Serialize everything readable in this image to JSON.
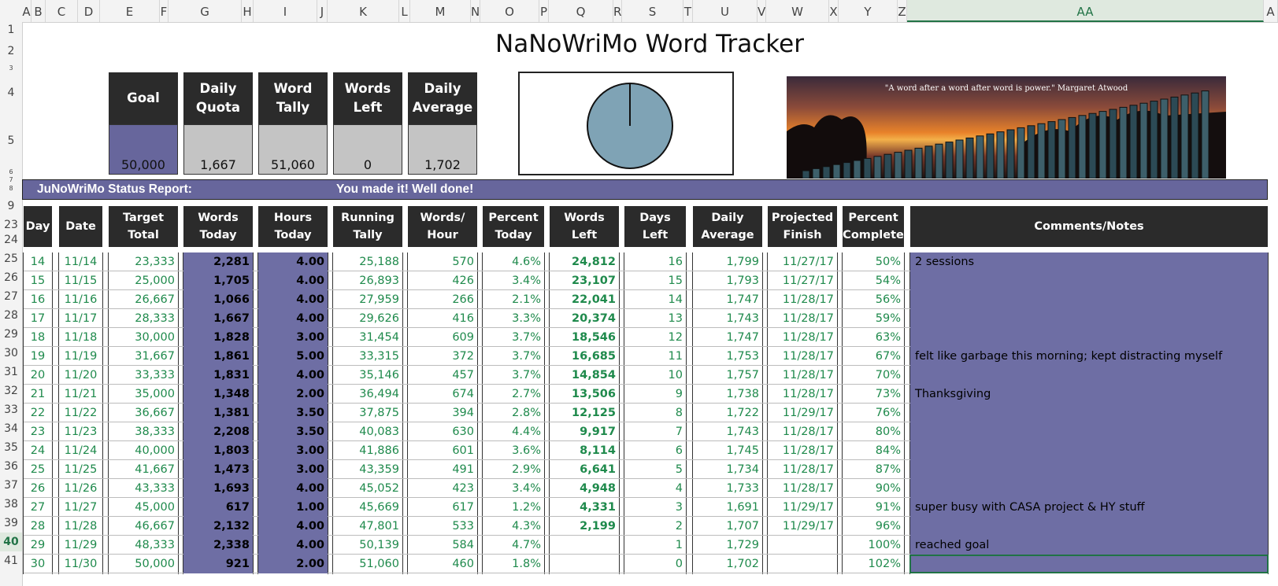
{
  "columns": [
    "A",
    "B",
    "C",
    "D",
    "E",
    "F",
    "G",
    "H",
    "I",
    "J",
    "K",
    "L",
    "M",
    "N",
    "O",
    "P",
    "Q",
    "R",
    "S",
    "T",
    "U",
    "V",
    "W",
    "X",
    "Y",
    "Z",
    "AA",
    "A"
  ],
  "selected_column": "AA",
  "row_numbers": [
    "1",
    "2",
    "3",
    "4",
    "5",
    "6",
    "7",
    "8",
    "9",
    "23",
    "24",
    "25",
    "26",
    "27",
    "28",
    "29",
    "30",
    "31",
    "32",
    "33",
    "34",
    "35",
    "36",
    "37",
    "38",
    "39",
    "40",
    "41"
  ],
  "selected_row": "40",
  "title": "NaNoWriMo Word Tracker",
  "stats": [
    {
      "label": "Goal",
      "value": "50,000"
    },
    {
      "label": "Daily Quota",
      "value": "1,667"
    },
    {
      "label": "Word Tally",
      "value": "51,060"
    },
    {
      "label": "Words Left",
      "value": "0"
    },
    {
      "label": "Daily Average",
      "value": "1,702"
    }
  ],
  "pie_complete_fraction": 1.0,
  "image_quote": "\"A word after a word after word is power.\" Margaret Atwood",
  "status": {
    "label": "JuNoWriMo Status Report:",
    "message": "You made it! Well done!"
  },
  "table_headers": [
    "Day",
    "Date",
    "Target Total",
    "Words Today",
    "Hours Today",
    "Running Tally",
    "Words/ Hour",
    "Percent Today",
    "Words Left",
    "Days Left",
    "Daily Average",
    "Projected Finish",
    "Percent Complete",
    "Comments/Notes"
  ],
  "rows": [
    {
      "rn": "24",
      "day": "14",
      "date": "11/14",
      "target": "23,333",
      "words": "2,281",
      "hours": "4.00",
      "tally": "25,188",
      "wph": "570",
      "pct_today": "4.6%",
      "left": "24,812",
      "days_left": "16",
      "avg": "1,799",
      "finish": "11/27/17",
      "pct_complete": "50%",
      "note": "2 sessions"
    },
    {
      "rn": "25",
      "day": "15",
      "date": "11/15",
      "target": "25,000",
      "words": "1,705",
      "hours": "4.00",
      "tally": "26,893",
      "wph": "426",
      "pct_today": "3.4%",
      "left": "23,107",
      "days_left": "15",
      "avg": "1,793",
      "finish": "11/27/17",
      "pct_complete": "54%",
      "note": ""
    },
    {
      "rn": "26",
      "day": "16",
      "date": "11/16",
      "target": "26,667",
      "words": "1,066",
      "hours": "4.00",
      "tally": "27,959",
      "wph": "266",
      "pct_today": "2.1%",
      "left": "22,041",
      "days_left": "14",
      "avg": "1,747",
      "finish": "11/28/17",
      "pct_complete": "56%",
      "note": ""
    },
    {
      "rn": "27",
      "day": "17",
      "date": "11/17",
      "target": "28,333",
      "words": "1,667",
      "hours": "4.00",
      "tally": "29,626",
      "wph": "416",
      "pct_today": "3.3%",
      "left": "20,374",
      "days_left": "13",
      "avg": "1,743",
      "finish": "11/28/17",
      "pct_complete": "59%",
      "note": ""
    },
    {
      "rn": "28",
      "day": "18",
      "date": "11/18",
      "target": "30,000",
      "words": "1,828",
      "hours": "3.00",
      "tally": "31,454",
      "wph": "609",
      "pct_today": "3.7%",
      "left": "18,546",
      "days_left": "12",
      "avg": "1,747",
      "finish": "11/28/17",
      "pct_complete": "63%",
      "note": ""
    },
    {
      "rn": "29",
      "day": "19",
      "date": "11/19",
      "target": "31,667",
      "words": "1,861",
      "hours": "5.00",
      "tally": "33,315",
      "wph": "372",
      "pct_today": "3.7%",
      "left": "16,685",
      "days_left": "11",
      "avg": "1,753",
      "finish": "11/28/17",
      "pct_complete": "67%",
      "note": "felt like garbage this morning; kept distracting myself"
    },
    {
      "rn": "30",
      "day": "20",
      "date": "11/20",
      "target": "33,333",
      "words": "1,831",
      "hours": "4.00",
      "tally": "35,146",
      "wph": "457",
      "pct_today": "3.7%",
      "left": "14,854",
      "days_left": "10",
      "avg": "1,757",
      "finish": "11/28/17",
      "pct_complete": "70%",
      "note": ""
    },
    {
      "rn": "31",
      "day": "21",
      "date": "11/21",
      "target": "35,000",
      "words": "1,348",
      "hours": "2.00",
      "tally": "36,494",
      "wph": "674",
      "pct_today": "2.7%",
      "left": "13,506",
      "days_left": "9",
      "avg": "1,738",
      "finish": "11/28/17",
      "pct_complete": "73%",
      "note": "Thanksgiving"
    },
    {
      "rn": "32",
      "day": "22",
      "date": "11/22",
      "target": "36,667",
      "words": "1,381",
      "hours": "3.50",
      "tally": "37,875",
      "wph": "394",
      "pct_today": "2.8%",
      "left": "12,125",
      "days_left": "8",
      "avg": "1,722",
      "finish": "11/29/17",
      "pct_complete": "76%",
      "note": ""
    },
    {
      "rn": "33",
      "day": "23",
      "date": "11/23",
      "target": "38,333",
      "words": "2,208",
      "hours": "3.50",
      "tally": "40,083",
      "wph": "630",
      "pct_today": "4.4%",
      "left": "9,917",
      "days_left": "7",
      "avg": "1,743",
      "finish": "11/28/17",
      "pct_complete": "80%",
      "note": ""
    },
    {
      "rn": "34",
      "day": "24",
      "date": "11/24",
      "target": "40,000",
      "words": "1,803",
      "hours": "3.00",
      "tally": "41,886",
      "wph": "601",
      "pct_today": "3.6%",
      "left": "8,114",
      "days_left": "6",
      "avg": "1,745",
      "finish": "11/28/17",
      "pct_complete": "84%",
      "note": ""
    },
    {
      "rn": "35",
      "day": "25",
      "date": "11/25",
      "target": "41,667",
      "words": "1,473",
      "hours": "3.00",
      "tally": "43,359",
      "wph": "491",
      "pct_today": "2.9%",
      "left": "6,641",
      "days_left": "5",
      "avg": "1,734",
      "finish": "11/28/17",
      "pct_complete": "87%",
      "note": ""
    },
    {
      "rn": "36",
      "day": "26",
      "date": "11/26",
      "target": "43,333",
      "words": "1,693",
      "hours": "4.00",
      "tally": "45,052",
      "wph": "423",
      "pct_today": "3.4%",
      "left": "4,948",
      "days_left": "4",
      "avg": "1,733",
      "finish": "11/28/17",
      "pct_complete": "90%",
      "note": ""
    },
    {
      "rn": "37",
      "day": "27",
      "date": "11/27",
      "target": "45,000",
      "words": "617",
      "hours": "1.00",
      "tally": "45,669",
      "wph": "617",
      "pct_today": "1.2%",
      "left": "4,331",
      "days_left": "3",
      "avg": "1,691",
      "finish": "11/29/17",
      "pct_complete": "91%",
      "note": "super busy with CASA project & HY stuff"
    },
    {
      "rn": "38",
      "day": "28",
      "date": "11/28",
      "target": "46,667",
      "words": "2,132",
      "hours": "4.00",
      "tally": "47,801",
      "wph": "533",
      "pct_today": "4.3%",
      "left": "2,199",
      "days_left": "2",
      "avg": "1,707",
      "finish": "11/29/17",
      "pct_complete": "96%",
      "note": ""
    },
    {
      "rn": "39",
      "day": "29",
      "date": "11/29",
      "target": "48,333",
      "words": "2,338",
      "hours": "4.00",
      "tally": "50,139",
      "wph": "584",
      "pct_today": "4.7%",
      "left": "",
      "days_left": "1",
      "avg": "1,729",
      "finish": "",
      "pct_complete": "100%",
      "note": "reached goal"
    },
    {
      "rn": "40",
      "day": "30",
      "date": "11/30",
      "target": "50,000",
      "words": "921",
      "hours": "2.00",
      "tally": "51,060",
      "wph": "460",
      "pct_today": "1.8%",
      "left": "",
      "days_left": "0",
      "avg": "1,702",
      "finish": "",
      "pct_complete": "102%",
      "note": ""
    }
  ],
  "colors": {
    "accent_purple": "#67669c",
    "header_dark": "#2b2b2b",
    "value_green": "#1f8a4c",
    "stat_gray": "#c4c4c4",
    "pie": "#7fa3b5"
  }
}
